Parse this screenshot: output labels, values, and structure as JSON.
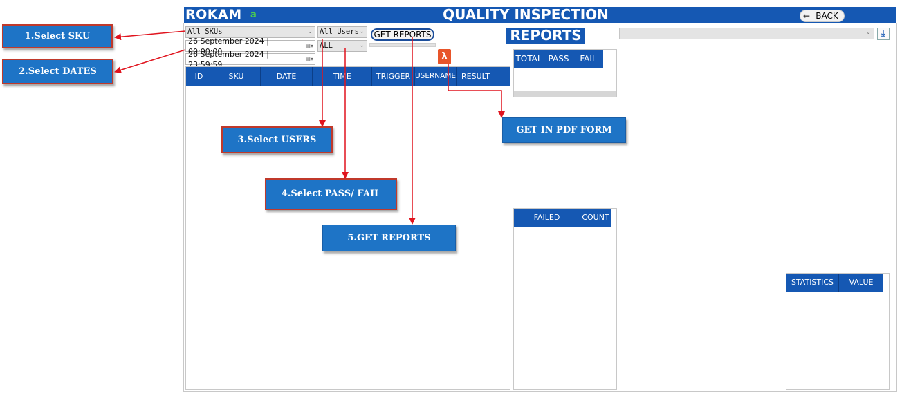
{
  "header": {
    "brand": "ROKAM",
    "brand_sub": "a",
    "title": "QUALITY INSPECTION",
    "back_label": "BACK",
    "back_icon": "arrow-left-icon",
    "bar_color": "#1558b3"
  },
  "filters": {
    "sku_select": "All SKUs",
    "start_datetime": "26 September 2024 | 00:00:00",
    "end_datetime": "26 September 2024 | 23:59:59",
    "users_select": "All Users",
    "result_select": "ALL",
    "get_reports_label": "GET REPORTS",
    "pdf_icon": "pdf-icon"
  },
  "main_table": {
    "columns": [
      "ID",
      "SKU",
      "DATE",
      "TIME",
      "TRIGGER",
      "USERNAME",
      "RESULT"
    ],
    "rows": []
  },
  "reports": {
    "title": "REPORTS",
    "select_value": "",
    "download_icon": "download-icon",
    "summary_columns": [
      "TOTAL",
      "PASS",
      "FAIL"
    ],
    "failed_columns": [
      "FAILED",
      "COUNT"
    ],
    "stats_columns": [
      "STATISTICS",
      "VALUE"
    ]
  },
  "callouts": {
    "select_sku": "1.Select SKU",
    "select_dates": "2.Select DATES",
    "select_users": "3.Select USERS",
    "select_pass_fail": "4.Select PASS/ FAIL",
    "get_reports": "5.GET REPORTS",
    "get_pdf": "GET  IN PDF FORM"
  },
  "colors": {
    "accent": "#1558b3",
    "callout": "#1e74c6",
    "arrow": "#e0141e",
    "pdf": "#e8552a"
  }
}
